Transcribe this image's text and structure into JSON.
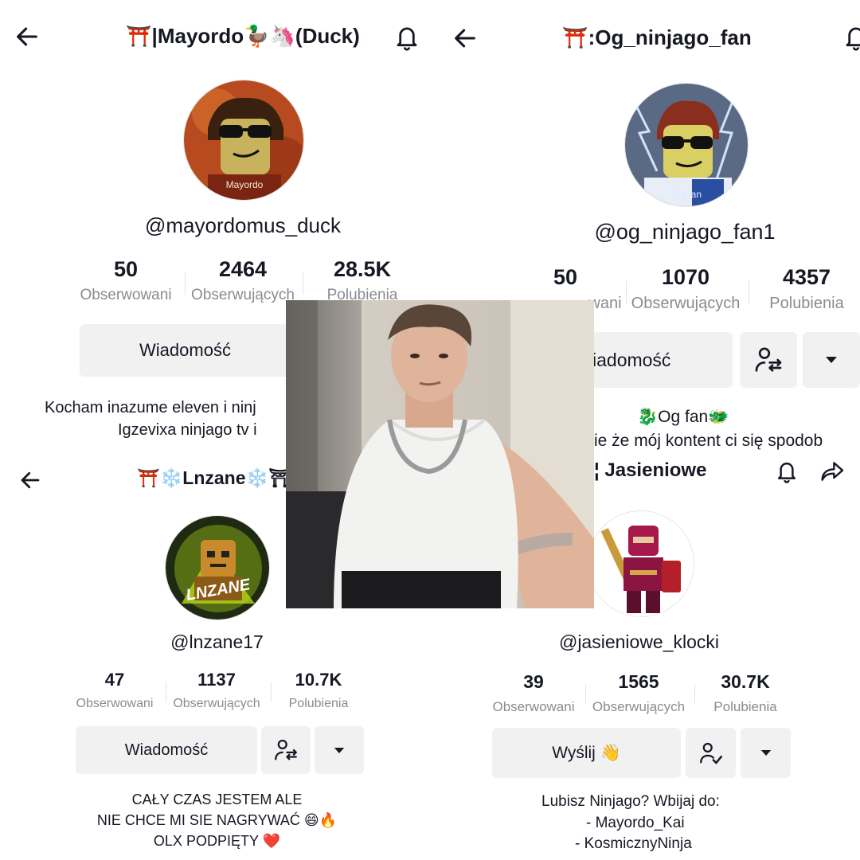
{
  "profiles": [
    {
      "title": "⛩️|Mayordo🦆🦄(Duck)",
      "avatar_caption": "Mayordo",
      "username": "@mayordomus_duck",
      "following": "50",
      "following_label": "Obserwowani",
      "followers": "2464",
      "followers_label": "Obserwujących",
      "likes": "28.5K",
      "likes_label": "Polubienia",
      "message_button": "Wiadomość",
      "bio": [
        "Kocham inazume eleven i ninj",
        "Igzevixa ninjago tv i"
      ]
    },
    {
      "title": "⛩️:Og_ninjago_fan",
      "avatar_caption": "Og fan",
      "username": "@og_ninjago_fan1",
      "following": "50",
      "following_label": "wani",
      "followers": "1070",
      "followers_label": "Obserwujących",
      "likes": "4357",
      "likes_label": "Polubienia",
      "message_button": "iadomość",
      "bio": [
        "🐉Og fan🐲",
        "ie że mój kontent ci się spodob"
      ]
    },
    {
      "title": "⛩️❄️Lnzane❄️⛩",
      "avatar_caption": "LNZANE",
      "username": "@lnzane17",
      "following": "47",
      "following_label": "Obserwowani",
      "followers": "1137",
      "followers_label": "Obserwujących",
      "likes": "10.7K",
      "likes_label": "Polubienia",
      "message_button": "Wiadomość",
      "bio": [
        "CAŁY CZAS JESTEM ALE",
        "NIE CHCE MI SIE NAGRYWAĆ 😄🔥",
        "OLX PODPIĘTY ❤️"
      ]
    },
    {
      "title": "¦ Jasieniowe",
      "username": "@jasieniowe_klocki",
      "following": "39",
      "following_label": "Obserwowani",
      "followers": "1565",
      "followers_label": "Obserwujących",
      "likes": "30.7K",
      "likes_label": "Polubienia",
      "message_button": "Wyślij 👋",
      "bio": [
        "Lubisz Ninjago? Wbijaj do:",
        "- Mayordo_Kai",
        "- KosmicznyNinja"
      ]
    }
  ],
  "icons": {
    "back": "arrow-left-icon",
    "bell": "bell-icon",
    "share": "share-icon",
    "friends": "user-swap-icon",
    "following": "user-check-icon",
    "dropdown": "caret-down-icon"
  },
  "colors": {
    "text": "#161823",
    "secondary_text": "#8a8b91",
    "button_bg": "#f1f1f2",
    "torii_red": "#e0332e"
  }
}
